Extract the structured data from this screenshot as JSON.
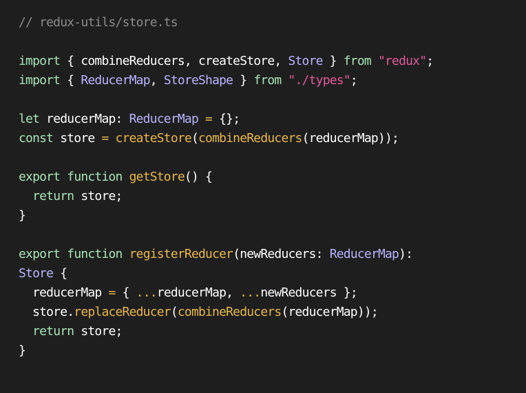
{
  "editor": {
    "colors": {
      "background": "#1e1e1e",
      "comment": "#8b8b8b",
      "keyword": "#a9e5b7",
      "type": "#b9b5ff",
      "string": "#e05a9c",
      "function": "#e8b84f",
      "plain": "#ffffff"
    },
    "lines": [
      [
        {
          "text": "// redux-utils/store.ts",
          "kind": "comment"
        }
      ],
      [],
      [
        {
          "text": "import",
          "kind": "keyword"
        },
        {
          "text": " { combineReducers, createStore, ",
          "kind": "plain"
        },
        {
          "text": "Store",
          "kind": "type"
        },
        {
          "text": " } ",
          "kind": "plain"
        },
        {
          "text": "from",
          "kind": "keyword"
        },
        {
          "text": " ",
          "kind": "plain"
        },
        {
          "text": "\"redux\"",
          "kind": "string"
        },
        {
          "text": ";",
          "kind": "plain"
        }
      ],
      [
        {
          "text": "import",
          "kind": "keyword"
        },
        {
          "text": " { ",
          "kind": "plain"
        },
        {
          "text": "ReducerMap",
          "kind": "type"
        },
        {
          "text": ", ",
          "kind": "plain"
        },
        {
          "text": "StoreShape",
          "kind": "type"
        },
        {
          "text": " } ",
          "kind": "plain"
        },
        {
          "text": "from",
          "kind": "keyword"
        },
        {
          "text": " ",
          "kind": "plain"
        },
        {
          "text": "\"./types\"",
          "kind": "string"
        },
        {
          "text": ";",
          "kind": "plain"
        }
      ],
      [],
      [
        {
          "text": "let",
          "kind": "keyword"
        },
        {
          "text": " reducerMap: ",
          "kind": "plain"
        },
        {
          "text": "ReducerMap",
          "kind": "type"
        },
        {
          "text": " ",
          "kind": "plain"
        },
        {
          "text": "=",
          "kind": "function"
        },
        {
          "text": " {};",
          "kind": "plain"
        }
      ],
      [
        {
          "text": "const",
          "kind": "keyword"
        },
        {
          "text": " store ",
          "kind": "plain"
        },
        {
          "text": "=",
          "kind": "function"
        },
        {
          "text": " ",
          "kind": "plain"
        },
        {
          "text": "createStore",
          "kind": "function"
        },
        {
          "text": "(",
          "kind": "plain"
        },
        {
          "text": "combineReducers",
          "kind": "function"
        },
        {
          "text": "(reducerMap));",
          "kind": "plain"
        }
      ],
      [],
      [
        {
          "text": "export",
          "kind": "keyword"
        },
        {
          "text": " ",
          "kind": "plain"
        },
        {
          "text": "function",
          "kind": "keyword"
        },
        {
          "text": " ",
          "kind": "plain"
        },
        {
          "text": "getStore",
          "kind": "function"
        },
        {
          "text": "() {",
          "kind": "plain"
        }
      ],
      [
        {
          "text": "  ",
          "kind": "plain"
        },
        {
          "text": "return",
          "kind": "keyword"
        },
        {
          "text": " store;",
          "kind": "plain"
        }
      ],
      [
        {
          "text": "}",
          "kind": "plain"
        }
      ],
      [],
      [
        {
          "text": "export",
          "kind": "keyword"
        },
        {
          "text": " ",
          "kind": "plain"
        },
        {
          "text": "function",
          "kind": "keyword"
        },
        {
          "text": " ",
          "kind": "plain"
        },
        {
          "text": "registerReducer",
          "kind": "function"
        },
        {
          "text": "(newReducers: ",
          "kind": "plain"
        },
        {
          "text": "ReducerMap",
          "kind": "type"
        },
        {
          "text": "):",
          "kind": "plain"
        }
      ],
      [
        {
          "text": "Store",
          "kind": "type"
        },
        {
          "text": " {",
          "kind": "plain"
        }
      ],
      [
        {
          "text": "  reducerMap ",
          "kind": "plain"
        },
        {
          "text": "=",
          "kind": "function"
        },
        {
          "text": " { ",
          "kind": "plain"
        },
        {
          "text": "...",
          "kind": "function"
        },
        {
          "text": "reducerMap, ",
          "kind": "plain"
        },
        {
          "text": "...",
          "kind": "function"
        },
        {
          "text": "newReducers };",
          "kind": "plain"
        }
      ],
      [
        {
          "text": "  store.",
          "kind": "plain"
        },
        {
          "text": "replaceReducer",
          "kind": "function"
        },
        {
          "text": "(",
          "kind": "plain"
        },
        {
          "text": "combineReducers",
          "kind": "function"
        },
        {
          "text": "(reducerMap));",
          "kind": "plain"
        }
      ],
      [
        {
          "text": "  ",
          "kind": "plain"
        },
        {
          "text": "return",
          "kind": "keyword"
        },
        {
          "text": " store;",
          "kind": "plain"
        }
      ],
      [
        {
          "text": "}",
          "kind": "plain"
        }
      ]
    ]
  }
}
